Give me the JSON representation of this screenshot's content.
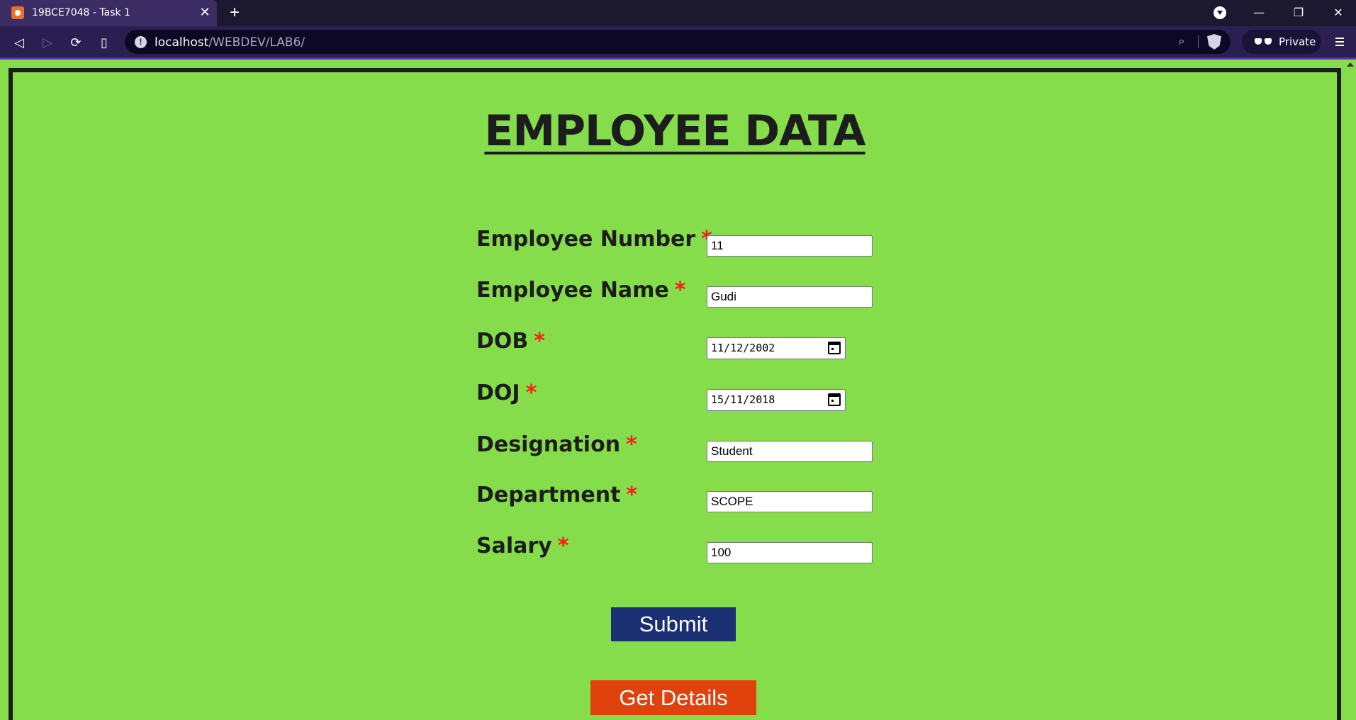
{
  "browser": {
    "tab_title": "19BCE7048 - Task 1",
    "url_host": "localhost",
    "url_path": "/WEBDEV/LAB6/",
    "private_label": "Private"
  },
  "page": {
    "heading": "EMPLOYEE DATA",
    "required_marker": "*",
    "fields": {
      "emp_number": {
        "label": "Employee Number",
        "value": "11"
      },
      "emp_name": {
        "label": "Employee Name",
        "value": "Gudi"
      },
      "dob": {
        "label": "DOB",
        "value": "11/12/2002"
      },
      "doj": {
        "label": "DOJ",
        "value": "15/11/2018"
      },
      "designation": {
        "label": "Designation",
        "value": "Student"
      },
      "department": {
        "label": "Department",
        "value": "SCOPE"
      },
      "salary": {
        "label": "Salary",
        "value": "100"
      }
    },
    "submit_label": "Submit",
    "get_details_label": "Get Details"
  },
  "colors": {
    "page_bg": "#86dd4b",
    "submit_bg": "#1b2f73",
    "details_bg": "#e0420e",
    "required": "#ff1a1a"
  }
}
